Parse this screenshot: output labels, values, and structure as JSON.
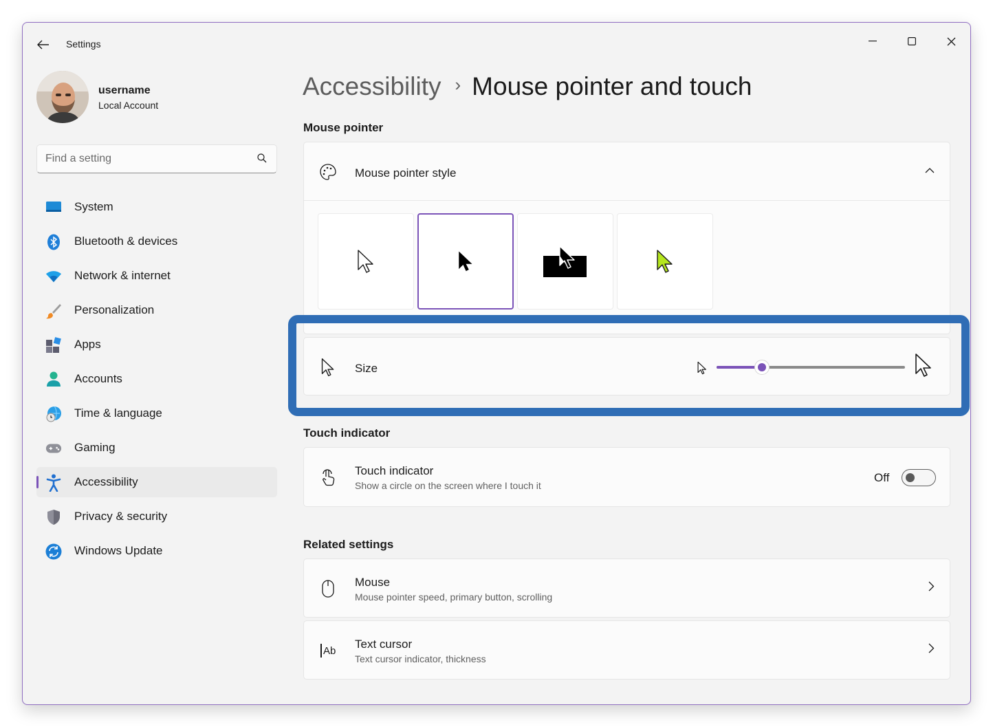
{
  "app": {
    "title": "Settings"
  },
  "user": {
    "name": "username",
    "account_type": "Local Account"
  },
  "search": {
    "placeholder": "Find a setting"
  },
  "nav": {
    "items": [
      {
        "label": "System",
        "icon": "monitor-icon"
      },
      {
        "label": "Bluetooth & devices",
        "icon": "bluetooth-icon"
      },
      {
        "label": "Network & internet",
        "icon": "wifi-icon"
      },
      {
        "label": "Personalization",
        "icon": "paintbrush-icon"
      },
      {
        "label": "Apps",
        "icon": "apps-icon"
      },
      {
        "label": "Accounts",
        "icon": "person-icon"
      },
      {
        "label": "Time & language",
        "icon": "globe-clock-icon"
      },
      {
        "label": "Gaming",
        "icon": "gamepad-icon"
      },
      {
        "label": "Accessibility",
        "icon": "accessibility-icon",
        "selected": true
      },
      {
        "label": "Privacy & security",
        "icon": "shield-icon"
      },
      {
        "label": "Windows Update",
        "icon": "update-icon"
      }
    ]
  },
  "breadcrumb": {
    "parent": "Accessibility",
    "separator": "›",
    "current": "Mouse pointer and touch"
  },
  "mouse_pointer": {
    "section_label": "Mouse pointer",
    "style_title": "Mouse pointer style",
    "style_options": [
      {
        "name": "white",
        "selected": false
      },
      {
        "name": "black",
        "selected": true
      },
      {
        "name": "inverted",
        "selected": false
      },
      {
        "name": "custom-lime",
        "selected": false
      }
    ],
    "size_title": "Size",
    "size_level_fraction": 0.24
  },
  "touch": {
    "section_label": "Touch indicator",
    "title": "Touch indicator",
    "description": "Show a circle on the screen where I touch it",
    "state_label": "Off"
  },
  "related": {
    "section_label": "Related settings",
    "items": [
      {
        "title": "Mouse",
        "description": "Mouse pointer speed, primary button, scrolling",
        "icon": "mouse-icon"
      },
      {
        "title": "Text cursor",
        "description": "Text cursor indicator, thickness",
        "icon": "text-cursor-icon"
      }
    ]
  },
  "colors": {
    "accent": "#7b53b8",
    "highlight_box": "#2f6db5",
    "custom_pointer": "#b5e61d"
  }
}
